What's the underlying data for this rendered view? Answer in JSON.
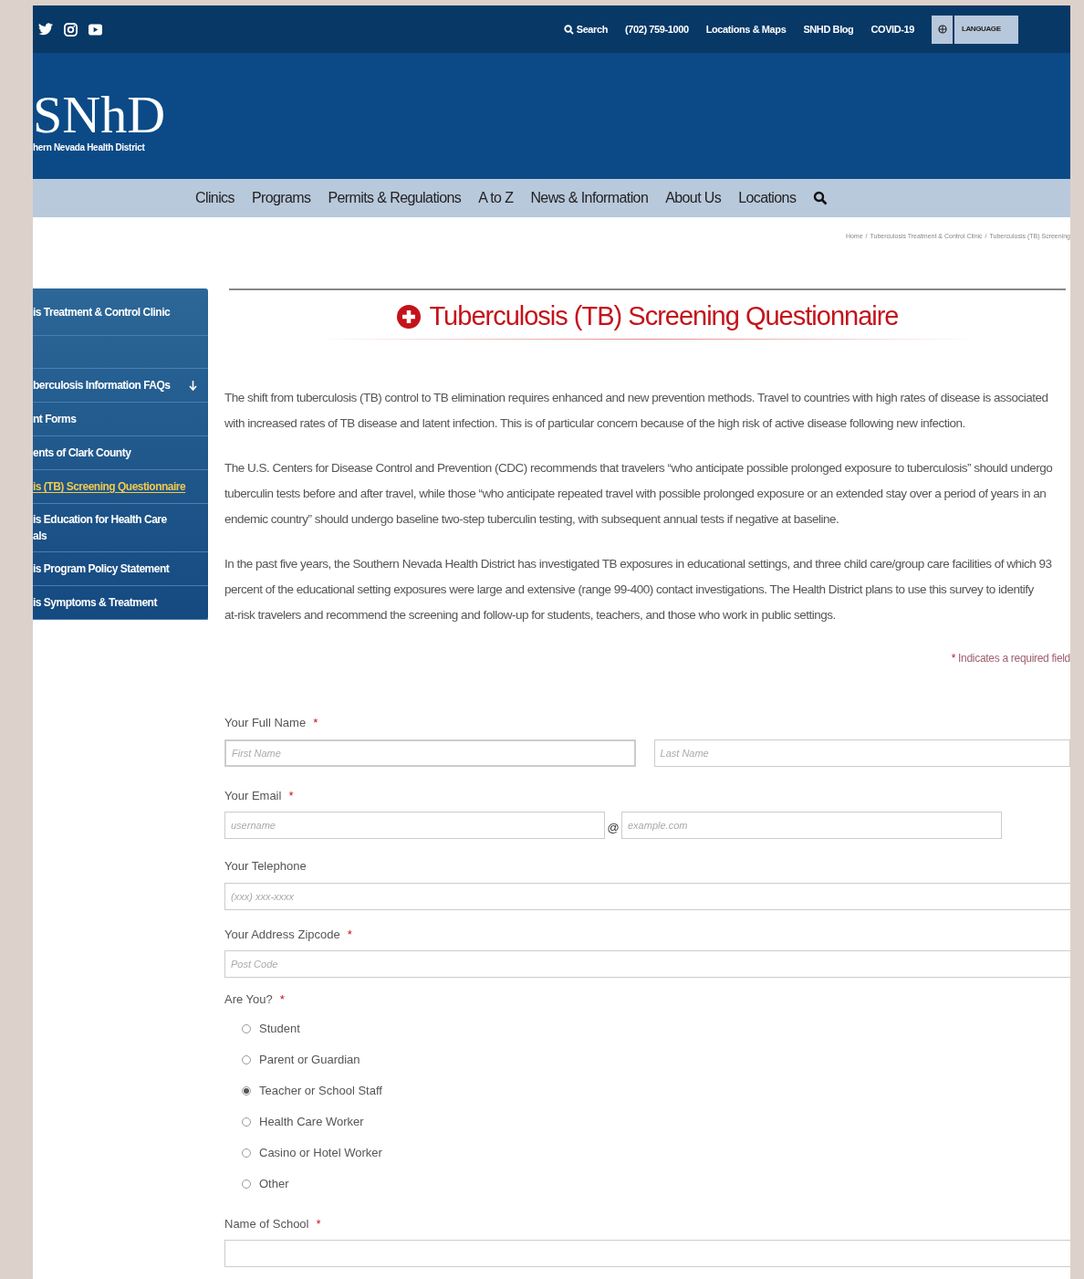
{
  "top_bar": {
    "links": [
      "Search",
      "(702) 759-1000",
      "Locations & Maps",
      "SNHD Blog",
      "COVID-19"
    ],
    "language_button": "LANGUAGE"
  },
  "logo": {
    "letters": "SNhD",
    "caption": "hern Nevada Health District"
  },
  "nav": {
    "items": [
      "Clinics",
      "Programs",
      "Permits & Regulations",
      "A to Z",
      "News & Information",
      "About Us",
      "Locations"
    ]
  },
  "breadcrumb": {
    "separator": "/",
    "items": [
      "Home",
      "Tuberculosis Treatment & Control Clinic",
      "Tuberculosis (TB) Screening"
    ]
  },
  "sidebar": {
    "items": [
      {
        "lines": [
          "is Treatment & Control Clinic"
        ],
        "selected": false,
        "expandable": false
      },
      {
        "lines": [
          "berculosis Information FAQs"
        ],
        "selected": false,
        "expandable": true
      },
      {
        "lines": [
          "nt Forms"
        ],
        "selected": false,
        "expandable": false
      },
      {
        "lines": [
          "ents of Clark County"
        ],
        "selected": false,
        "expandable": false
      },
      {
        "lines": [
          "is (TB) Screening Questionnaire"
        ],
        "selected": true,
        "expandable": false
      },
      {
        "lines": [
          "is Education for Health Care",
          "als"
        ],
        "selected": false,
        "expandable": false
      },
      {
        "lines": [
          "is Program Policy Statement"
        ],
        "selected": false,
        "expandable": false
      },
      {
        "lines": [
          "is Symptoms & Treatment"
        ],
        "selected": false,
        "expandable": false
      }
    ]
  },
  "title": "Tuberculosis (TB) Screening Questionnaire",
  "paragraphs": [
    [
      "The shift from tuberculosis (TB) control to TB elimination requires enhanced and new prevention methods. Travel to countries with high rates of disease is associated",
      "with increased rates of TB disease and latent infection. This is of particular concern because of the high risk of active disease following new infection."
    ],
    [
      "The U.S. Centers for Disease Control and Prevention (CDC) recommends that travelers “who anticipate possible prolonged exposure to tuberculosis” should undergo",
      "tuberculin tests before and after travel, while those “who anticipate repeated travel with possible prolonged exposure or an extended stay over a period of years in an",
      "endemic country” should undergo baseline two-step tuberculin testing, with subsequent annual tests if negative at baseline."
    ],
    [
      "In the past five years, the Southern Nevada Health District has investigated TB exposures in educational settings, and three child care/group care facilities of which 93",
      "percent of the educational setting exposures were large and extensive (range 99-400) contact investigations. The Health District plans to use this survey to identify",
      "at-risk travelers and recommend the screening and follow-up for students, teachers, and those who work in public settings."
    ]
  ],
  "required_note": {
    "mark": "*",
    "text": "Indicates a required field"
  },
  "form": {
    "full_name": {
      "label": "Your Full Name",
      "required_mark": "*",
      "first_placeholder": "First Name",
      "last_placeholder": "Last Name"
    },
    "email": {
      "label": "Your Email",
      "required_mark": "*",
      "user_placeholder": "username",
      "at": "@",
      "domain_placeholder": "example.com"
    },
    "telephone": {
      "label": "Your Telephone",
      "placeholder": "(xxx) xxx-xxxx"
    },
    "zipcode": {
      "label": "Your Address Zipcode",
      "required_mark": "*",
      "placeholder": "Post Code"
    },
    "are_you": {
      "label": "Are You?",
      "required_mark": "*",
      "options": [
        {
          "label": "Student",
          "selected": false
        },
        {
          "label": "Parent or Guardian",
          "selected": false
        },
        {
          "label": "Teacher or School Staff",
          "selected": true
        },
        {
          "label": "Health Care Worker",
          "selected": false
        },
        {
          "label": "Casino or Hotel Worker",
          "selected": false
        },
        {
          "label": "Other",
          "selected": false
        }
      ]
    },
    "school": {
      "label": "Name of School",
      "required_mark": "*"
    }
  }
}
